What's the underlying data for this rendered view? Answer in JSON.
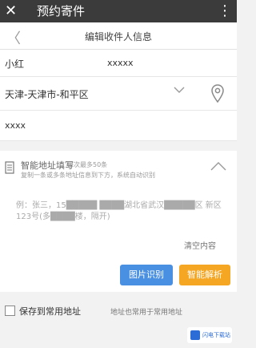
{
  "titlebar": {
    "close_glyph": "✕",
    "title": "预约寄件",
    "more_glyph": "⋮"
  },
  "subheader": {
    "back_glyph": "〈",
    "title": "编辑收件人信息"
  },
  "recipient": {
    "name": "小红",
    "phone": "xxxxx",
    "region": "天津-天津市-和平区",
    "detail": "xxxx"
  },
  "smart_fill": {
    "title": "智能地址填写",
    "hint": "每次最多50条",
    "hint2": "复制一条或多条地址信息到下方，系统自动识别",
    "text": "例：张三，15█████ ████湖北省武汉█████区 新区123号(多████楼，隔开)",
    "clear_label": "清空内容",
    "image_button": "图片识别",
    "parse_button": "智能解析"
  },
  "save": {
    "label": "保存到常用地址",
    "note": "地址也常用于常用地址"
  },
  "watermark": {
    "text": "闪电下载站"
  },
  "colors": {
    "titlebar": "#3b3b3b",
    "accent_blue": "#4a90e2",
    "accent_orange": "#f5a623"
  }
}
